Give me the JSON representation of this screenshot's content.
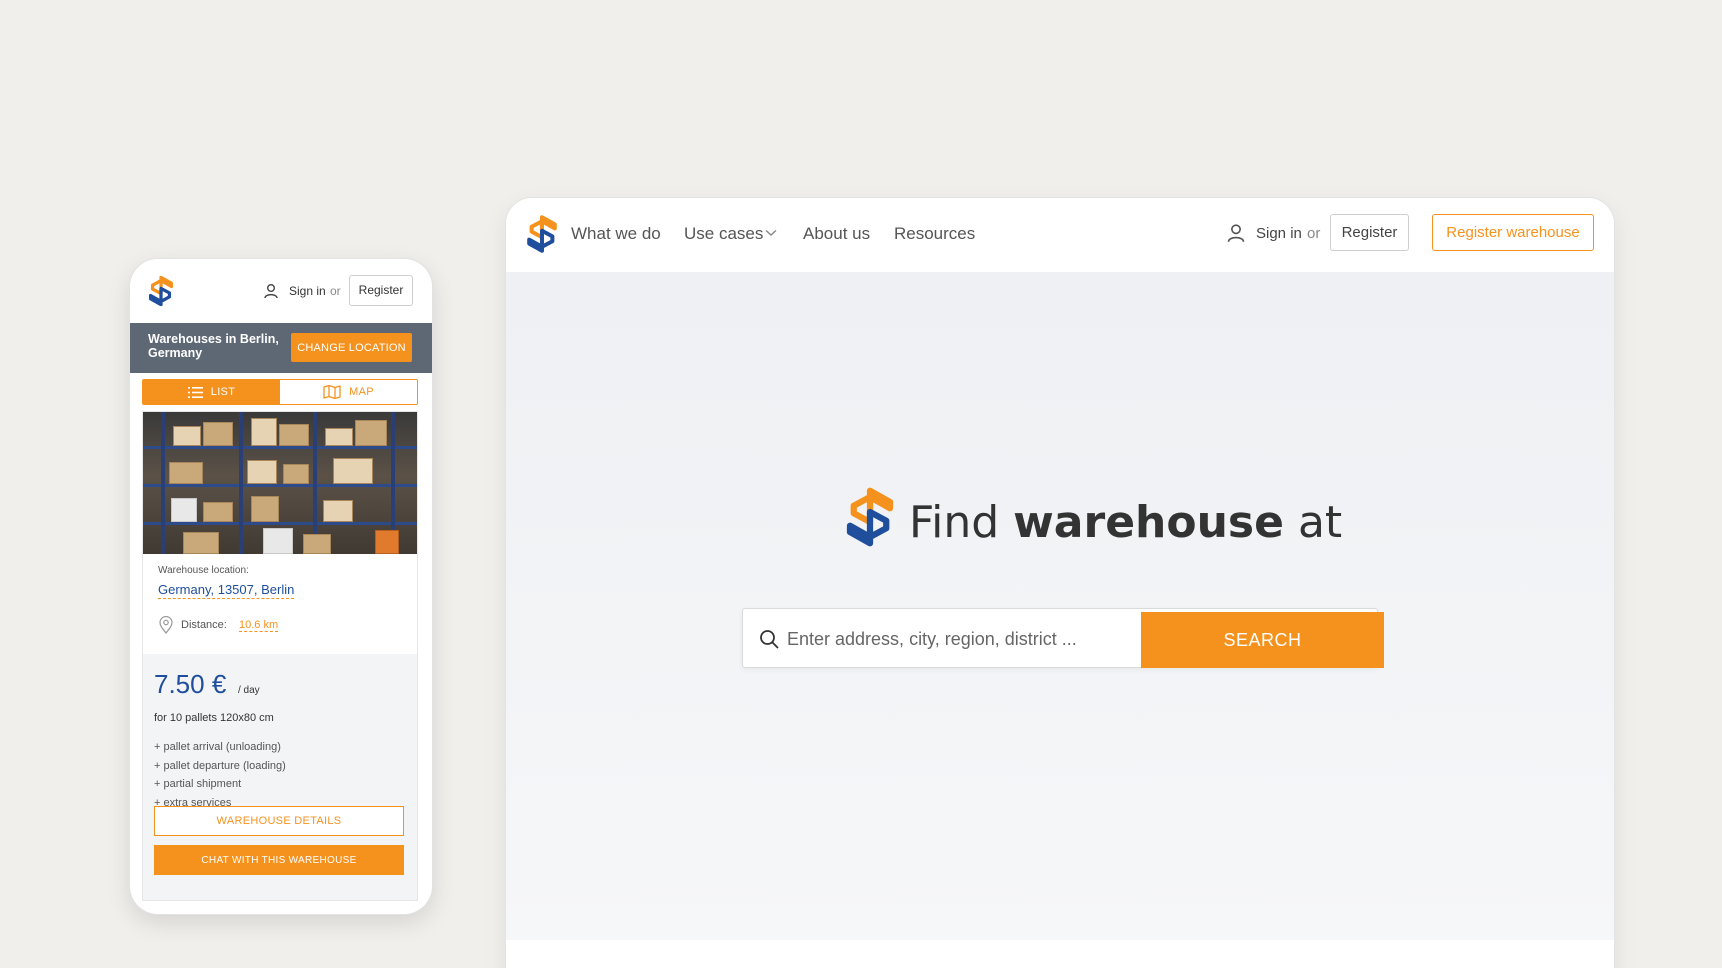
{
  "colors": {
    "accent": "#f5921e",
    "brand_blue": "#1f4e9c",
    "slate": "#5e6875",
    "background": "#f0efeb"
  },
  "mobile": {
    "header": {
      "signin_label": "Sign in",
      "or_label": "or",
      "register_label": "Register"
    },
    "location": {
      "text": "Warehouses in Berlin, Germany",
      "change_label": "CHANGE LOCATION"
    },
    "view_toggle": {
      "list_label": "LIST",
      "map_label": "MAP",
      "active": "list"
    },
    "card": {
      "location_label": "Warehouse location:",
      "location_value": "Germany, 13507, Berlin",
      "distance_label": "Distance:",
      "distance_value": "10.6 km",
      "price": "7.50 €",
      "price_unit": "/ day",
      "pallets": "for 10 pallets 120x80 cm",
      "services": [
        "+ pallet arrival (unloading)",
        "+ pallet departure (loading)",
        "+ partial shipment",
        "+ extra services"
      ],
      "details_label": "WAREHOUSE DETAILS",
      "chat_label": "CHAT WITH THIS WAREHOUSE"
    }
  },
  "desktop": {
    "nav": {
      "links": [
        "What we do",
        "Use cases",
        "About us",
        "Resources"
      ],
      "signin_label": "Sign in",
      "or_label": "or",
      "register_label": "Register",
      "register_warehouse_label": "Register warehouse"
    },
    "hero": {
      "title_prefix": "Find",
      "title_bold": "warehouse",
      "title_suffix": "at",
      "search_placeholder": "Enter address, city, region, district ...",
      "search_button_label": "SEARCH"
    }
  },
  "icons": [
    "logo-icon",
    "user-icon",
    "list-icon",
    "map-icon",
    "map-pin-icon",
    "chevron-down-icon",
    "search-icon"
  ]
}
